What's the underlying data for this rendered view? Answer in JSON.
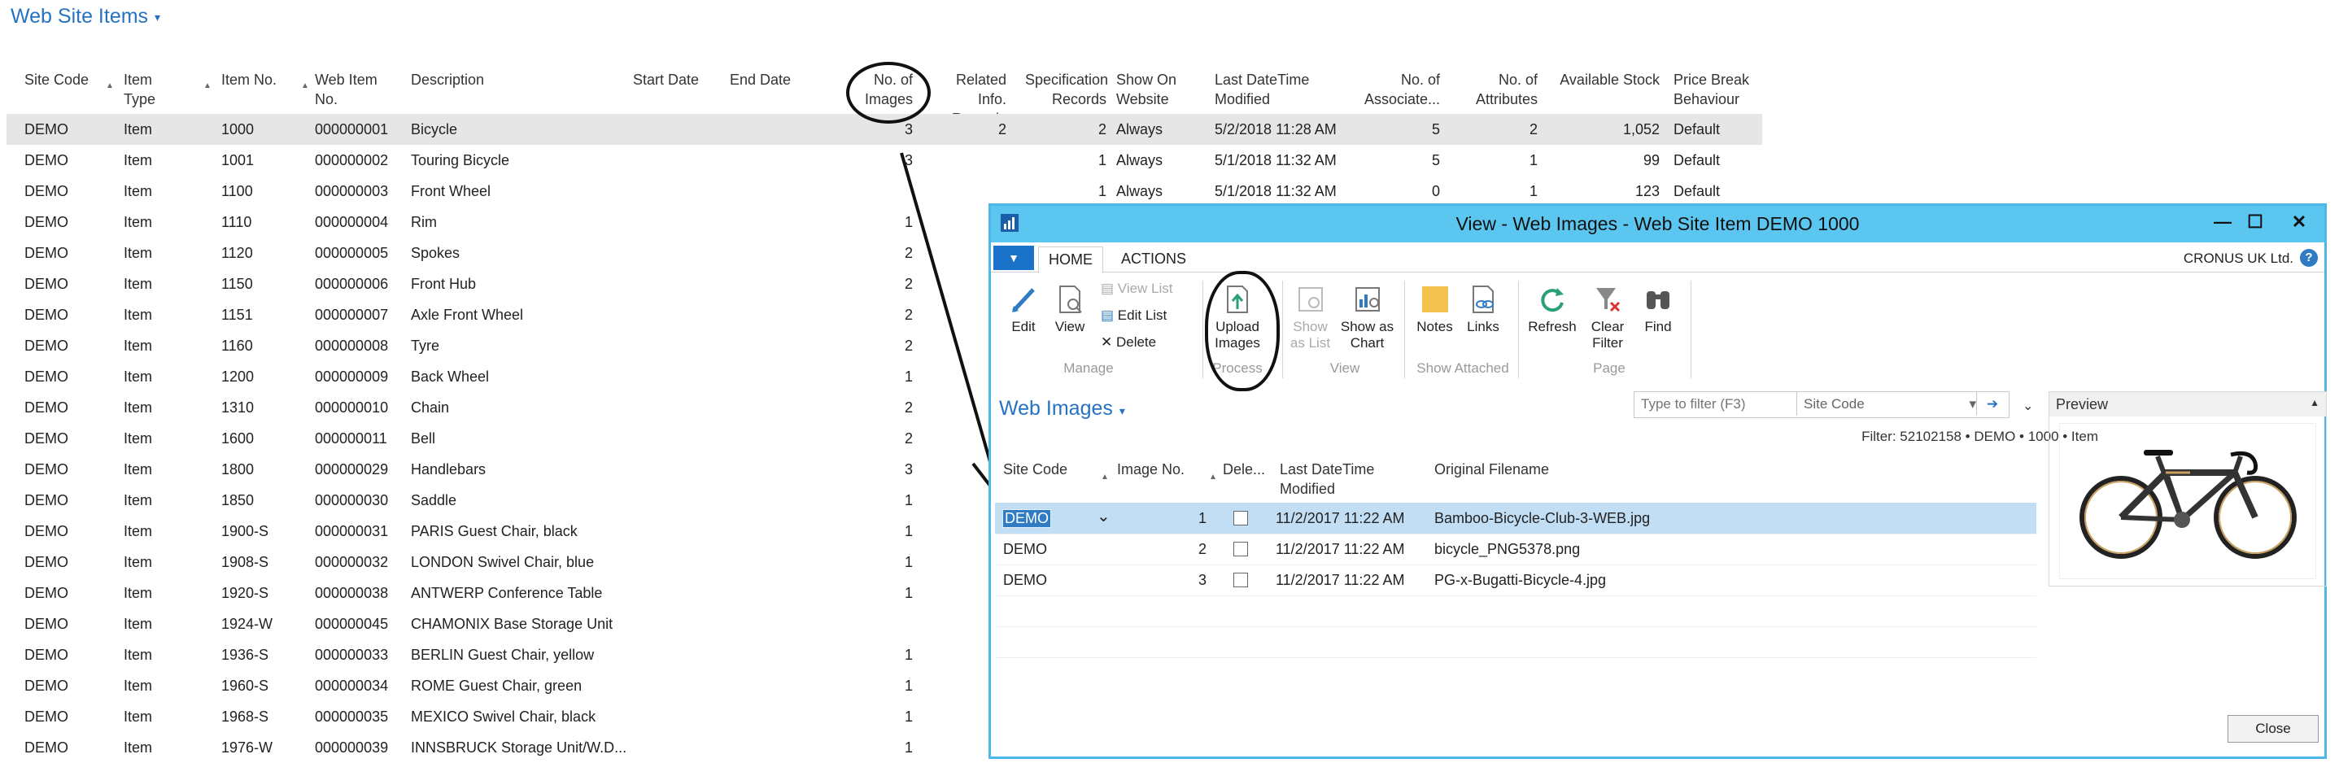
{
  "page": {
    "title": "Web Site Items",
    "columns": [
      "Site Code",
      "Item Type",
      "Item No.",
      "Web Item No.",
      "Description",
      "Start Date",
      "End Date",
      "No. of Images",
      "Related Info. Records",
      "Specification Records",
      "Show On Website",
      "Last DateTime Modified",
      "No. of Associate...",
      "No. of Attributes",
      "Available Stock",
      "Price Break Behaviour"
    ],
    "column_lines": [
      [
        "Site Code"
      ],
      [
        "Item",
        "Type"
      ],
      [
        "Item No."
      ],
      [
        "Web Item",
        "No."
      ],
      [
        "Description"
      ],
      [
        "Start Date"
      ],
      [
        "End Date"
      ],
      [
        "No. of",
        "Images"
      ],
      [
        "Related Info.",
        "Records"
      ],
      [
        "Specification",
        "Records"
      ],
      [
        "Show On",
        "Website"
      ],
      [
        "Last DateTime",
        "Modified"
      ],
      [
        "No. of",
        "Associate..."
      ],
      [
        "No. of",
        "Attributes"
      ],
      [
        "Available Stock"
      ],
      [
        "Price Break",
        "Behaviour"
      ]
    ],
    "rows": [
      [
        "DEMO",
        "Item",
        "1000",
        "000000001",
        "Bicycle",
        "",
        "",
        "3",
        "2",
        "2",
        "Always",
        "5/2/2018 11:28 AM",
        "5",
        "2",
        "1,052",
        "Default"
      ],
      [
        "DEMO",
        "Item",
        "1001",
        "000000002",
        "Touring Bicycle",
        "",
        "",
        "3",
        "",
        "1",
        "Always",
        "5/1/2018 11:32 AM",
        "5",
        "1",
        "99",
        "Default"
      ],
      [
        "DEMO",
        "Item",
        "1100",
        "000000003",
        "Front Wheel",
        "",
        "",
        "",
        "",
        "1",
        "Always",
        "5/1/2018 11:32 AM",
        "0",
        "1",
        "123",
        "Default"
      ],
      [
        "DEMO",
        "Item",
        "1110",
        "000000004",
        "Rim",
        "",
        "",
        "1",
        "",
        "",
        "",
        "",
        "",
        "",
        "",
        ""
      ],
      [
        "DEMO",
        "Item",
        "1120",
        "000000005",
        "Spokes",
        "",
        "",
        "2",
        "",
        "",
        "",
        "",
        "",
        "",
        "",
        ""
      ],
      [
        "DEMO",
        "Item",
        "1150",
        "000000006",
        "Front Hub",
        "",
        "",
        "2",
        "",
        "",
        "",
        "",
        "",
        "",
        "",
        ""
      ],
      [
        "DEMO",
        "Item",
        "1151",
        "000000007",
        "Axle Front Wheel",
        "",
        "",
        "2",
        "",
        "",
        "",
        "",
        "",
        "",
        "",
        ""
      ],
      [
        "DEMO",
        "Item",
        "1160",
        "000000008",
        "Tyre",
        "",
        "",
        "2",
        "",
        "",
        "",
        "",
        "",
        "",
        "",
        ""
      ],
      [
        "DEMO",
        "Item",
        "1200",
        "000000009",
        "Back Wheel",
        "",
        "",
        "1",
        "",
        "",
        "",
        "",
        "",
        "",
        "",
        ""
      ],
      [
        "DEMO",
        "Item",
        "1310",
        "000000010",
        "Chain",
        "",
        "",
        "2",
        "",
        "",
        "",
        "",
        "",
        "",
        "",
        ""
      ],
      [
        "DEMO",
        "Item",
        "1600",
        "000000011",
        "Bell",
        "",
        "",
        "2",
        "",
        "",
        "",
        "",
        "",
        "",
        "",
        ""
      ],
      [
        "DEMO",
        "Item",
        "1800",
        "000000029",
        "Handlebars",
        "",
        "",
        "3",
        "",
        "",
        "",
        "",
        "",
        "",
        "",
        ""
      ],
      [
        "DEMO",
        "Item",
        "1850",
        "000000030",
        "Saddle",
        "",
        "",
        "1",
        "",
        "",
        "",
        "",
        "",
        "",
        "",
        ""
      ],
      [
        "DEMO",
        "Item",
        "1900-S",
        "000000031",
        "PARIS Guest Chair, black",
        "",
        "",
        "1",
        "",
        "",
        "",
        "",
        "",
        "",
        "",
        ""
      ],
      [
        "DEMO",
        "Item",
        "1908-S",
        "000000032",
        "LONDON Swivel Chair, blue",
        "",
        "",
        "1",
        "",
        "",
        "",
        "",
        "",
        "",
        "",
        ""
      ],
      [
        "DEMO",
        "Item",
        "1920-S",
        "000000038",
        "ANTWERP Conference Table",
        "",
        "",
        "1",
        "",
        "",
        "",
        "",
        "",
        "",
        "",
        ""
      ],
      [
        "DEMO",
        "Item",
        "1924-W",
        "000000045",
        "CHAMONIX Base Storage Unit",
        "",
        "",
        "",
        "",
        "",
        "",
        "",
        "",
        "",
        "",
        ""
      ],
      [
        "DEMO",
        "Item",
        "1936-S",
        "000000033",
        "BERLIN Guest Chair, yellow",
        "",
        "",
        "1",
        "",
        "",
        "",
        "",
        "",
        "",
        "",
        ""
      ],
      [
        "DEMO",
        "Item",
        "1960-S",
        "000000034",
        "ROME Guest Chair, green",
        "",
        "",
        "1",
        "",
        "",
        "",
        "",
        "",
        "",
        "",
        ""
      ],
      [
        "DEMO",
        "Item",
        "1968-S",
        "000000035",
        "MEXICO Swivel Chair, black",
        "",
        "",
        "1",
        "",
        "",
        "",
        "",
        "",
        "",
        "",
        ""
      ],
      [
        "DEMO",
        "Item",
        "1976-W",
        "000000039",
        "INNSBRUCK Storage Unit/W.D...",
        "",
        "",
        "1",
        "",
        "",
        "",
        "",
        "",
        "",
        "",
        ""
      ]
    ]
  },
  "dialog": {
    "title": "View - Web Images - Web Site Item DEMO 1000",
    "tabs": [
      "HOME",
      "ACTIONS"
    ],
    "company": "CRONUS UK Ltd.",
    "ribbon": {
      "edit": "Edit",
      "view": "View",
      "view_list": "View List",
      "edit_list": "Edit List",
      "delete": "Delete",
      "upload_images": [
        "Upload",
        "Images"
      ],
      "show_as_list": [
        "Show",
        "as List"
      ],
      "show_as_chart": [
        "Show as",
        "Chart"
      ],
      "notes": "Notes",
      "links": "Links",
      "refresh": "Refresh",
      "clear_filter": [
        "Clear",
        "Filter"
      ],
      "find": "Find",
      "groups": [
        "Manage",
        "Process",
        "View",
        "Show Attached",
        "Page"
      ]
    },
    "subtitle": "Web Images",
    "filter_placeholder": "Type to filter (F3)",
    "filter_field": "Site Code",
    "filter_text": "Filter: 52102158 • DEMO • 1000 • Item",
    "columns": [
      "Site Code",
      "Image No.",
      "Dele...",
      "Last DateTime Modified",
      "Original Filename"
    ],
    "column_lines": [
      [
        "Site Code"
      ],
      [
        "Image No."
      ],
      [
        "Dele..."
      ],
      [
        "Last DateTime",
        "Modified"
      ],
      [
        "Original Filename"
      ]
    ],
    "rows": [
      {
        "site": "DEMO",
        "image_no": "1",
        "deleted": false,
        "modified": "11/2/2017 11:22 AM",
        "filename": "Bamboo-Bicycle-Club-3-WEB.jpg"
      },
      {
        "site": "DEMO",
        "image_no": "2",
        "deleted": false,
        "modified": "11/2/2017 11:22 AM",
        "filename": "bicycle_PNG5378.png"
      },
      {
        "site": "DEMO",
        "image_no": "3",
        "deleted": false,
        "modified": "11/2/2017 11:22 AM",
        "filename": "PG-x-Bugatti-Bicycle-4.jpg"
      }
    ],
    "preview_title": "Preview",
    "close_label": "Close"
  },
  "colors": {
    "accent": "#2672c2",
    "titlebar": "#5bc6ef",
    "selected_row": "#c2def5",
    "annotation": "#111111"
  }
}
